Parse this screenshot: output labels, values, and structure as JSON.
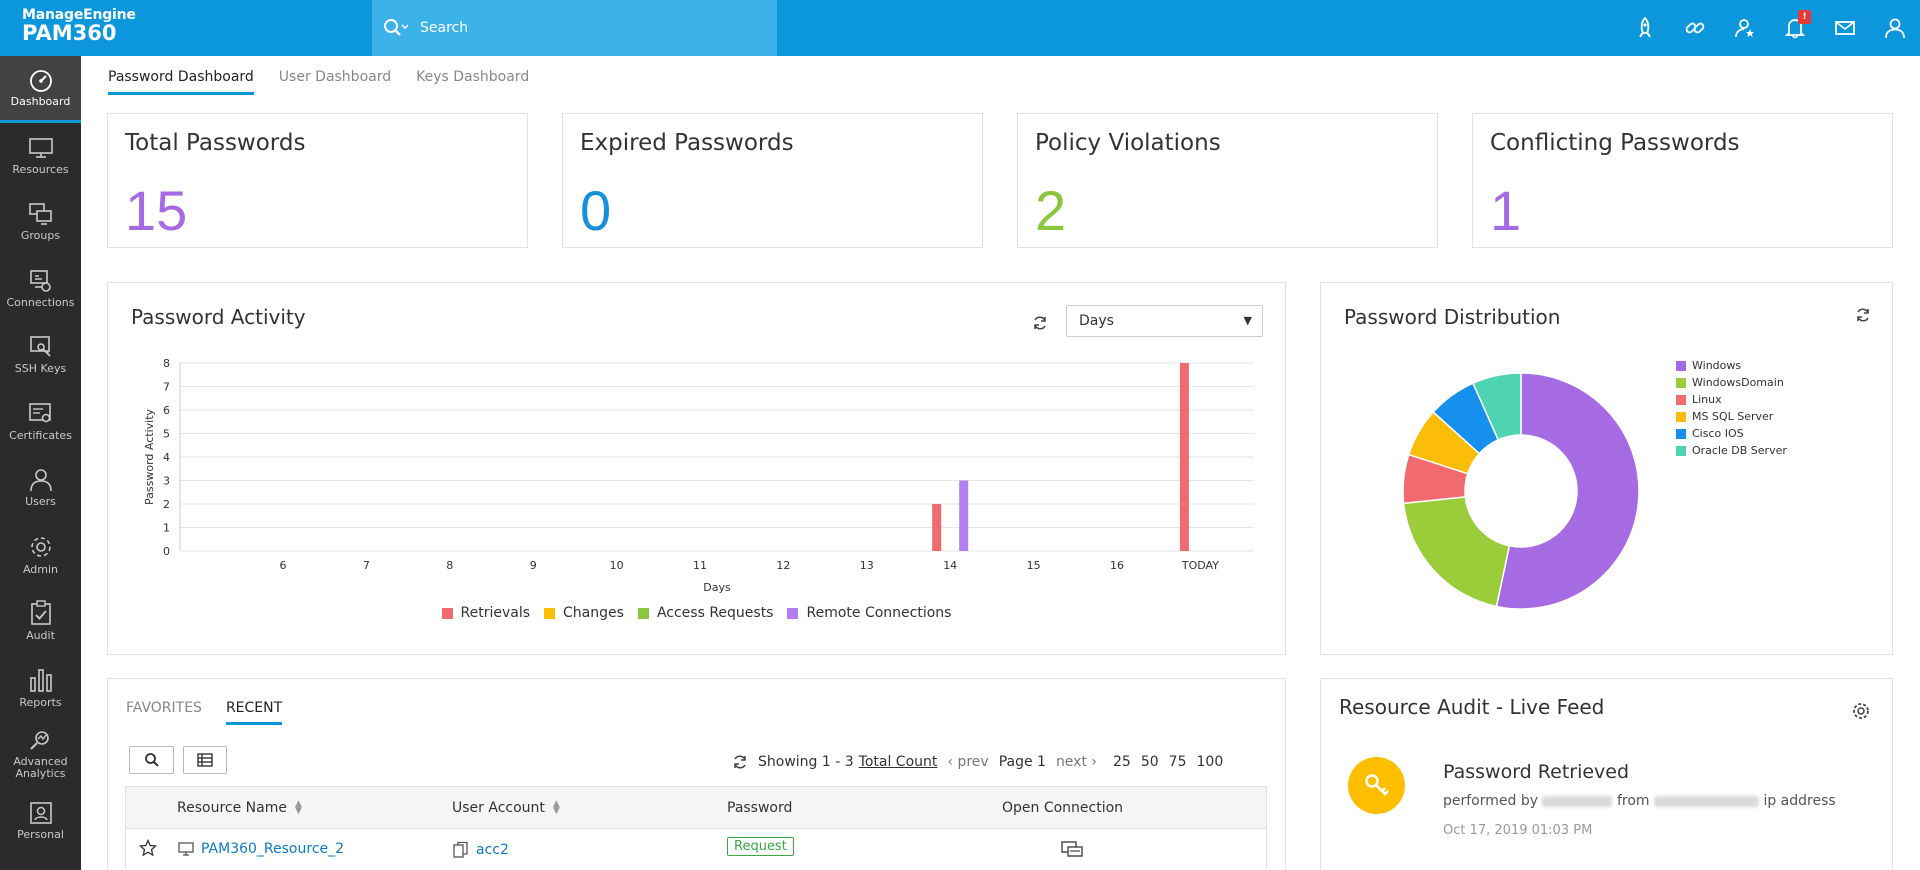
{
  "brand": {
    "top": "ManageEngine",
    "main": "PAM360"
  },
  "search": {
    "placeholder": "Search"
  },
  "topbar": {
    "notification_count": "!"
  },
  "sidebar": {
    "items": [
      {
        "label": "Dashboard",
        "icon": "speedometer-icon"
      },
      {
        "label": "Resources",
        "icon": "monitor-icon"
      },
      {
        "label": "Groups",
        "icon": "groups-icon"
      },
      {
        "label": "Connections",
        "icon": "connections-icon"
      },
      {
        "label": "SSH Keys",
        "icon": "ssh-key-icon"
      },
      {
        "label": "Certificates",
        "icon": "certificate-icon"
      },
      {
        "label": "Users",
        "icon": "user-icon"
      },
      {
        "label": "Admin",
        "icon": "gear-icon"
      },
      {
        "label": "Audit",
        "icon": "clipboard-icon"
      },
      {
        "label": "Reports",
        "icon": "bar-chart-icon"
      },
      {
        "label": "Advanced Analytics",
        "icon": "analytics-icon"
      },
      {
        "label": "Personal",
        "icon": "personal-icon"
      }
    ]
  },
  "dashboard_tabs": [
    "Password Dashboard",
    "User Dashboard",
    "Keys Dashboard"
  ],
  "stats": [
    {
      "label": "Total Passwords",
      "value": "15",
      "color": "#a66be3"
    },
    {
      "label": "Expired Passwords",
      "value": "0",
      "color": "#1690dd"
    },
    {
      "label": "Policy Violations",
      "value": "2",
      "color": "#8cc63f"
    },
    {
      "label": "Conflicting Passwords",
      "value": "1",
      "color": "#a66be3"
    }
  ],
  "activity": {
    "title": "Password Activity",
    "range_select": "Days"
  },
  "distribution": {
    "title": "Password Distribution"
  },
  "chart_data": [
    {
      "type": "bar",
      "ylabel": "Password Activity",
      "xlabel": "Days",
      "categories": [
        "6",
        "7",
        "8",
        "9",
        "10",
        "11",
        "12",
        "13",
        "14",
        "15",
        "16",
        "TODAY"
      ],
      "ylim": [
        0,
        8
      ],
      "yticks": [
        0,
        1,
        2,
        3,
        4,
        5,
        6,
        7,
        8
      ],
      "grid": true,
      "legend": "bottom",
      "series": [
        {
          "name": "Retrievals",
          "color": "#f06a6e",
          "values": [
            0,
            0,
            0,
            0,
            0,
            0,
            0,
            0,
            2,
            0,
            0,
            8
          ]
        },
        {
          "name": "Changes",
          "color": "#fbbd08",
          "values": [
            0,
            0,
            0,
            0,
            0,
            0,
            0,
            0,
            0,
            0,
            0,
            0
          ]
        },
        {
          "name": "Access Requests",
          "color": "#8cc63f",
          "values": [
            0,
            0,
            0,
            0,
            0,
            0,
            0,
            0,
            0,
            0,
            0,
            0
          ]
        },
        {
          "name": "Remote Connections",
          "color": "#b37ef0",
          "values": [
            0,
            0,
            0,
            0,
            0,
            0,
            0,
            0,
            3,
            0,
            0,
            0
          ]
        }
      ]
    },
    {
      "type": "pie",
      "donut": true,
      "legend": "right",
      "slices": [
        {
          "name": "Windows",
          "value": 8,
          "color": "#a66be3"
        },
        {
          "name": "WindowsDomain",
          "value": 3,
          "color": "#9bcc3a"
        },
        {
          "name": "Linux",
          "value": 1,
          "color": "#f06a6e"
        },
        {
          "name": "MS SQL Server",
          "value": 1,
          "color": "#fbbd08"
        },
        {
          "name": "Cisco IOS",
          "value": 1,
          "color": "#1690ee"
        },
        {
          "name": "Oracle DB Server",
          "value": 1,
          "color": "#4ed4b0"
        }
      ]
    }
  ],
  "recent": {
    "tabs": [
      "FAVORITES",
      "RECENT"
    ],
    "pager": {
      "showing": "Showing 1 - 3",
      "total": "Total Count",
      "prev": "prev",
      "page": "Page 1",
      "next": "next",
      "sizes": [
        "25",
        "50",
        "75",
        "100"
      ]
    },
    "columns": [
      "Resource Name",
      "User Account",
      "Password",
      "Open Connection"
    ],
    "rows": [
      {
        "resource": "PAM360_Resource_2",
        "account": "acc2",
        "password": "Request"
      }
    ]
  },
  "feed": {
    "title": "Resource Audit - Live Feed",
    "item_title": "Password Retrieved",
    "performed_by": "performed by",
    "from": "from",
    "ip_address": "ip address",
    "time": "Oct 17, 2019 01:03 PM"
  }
}
